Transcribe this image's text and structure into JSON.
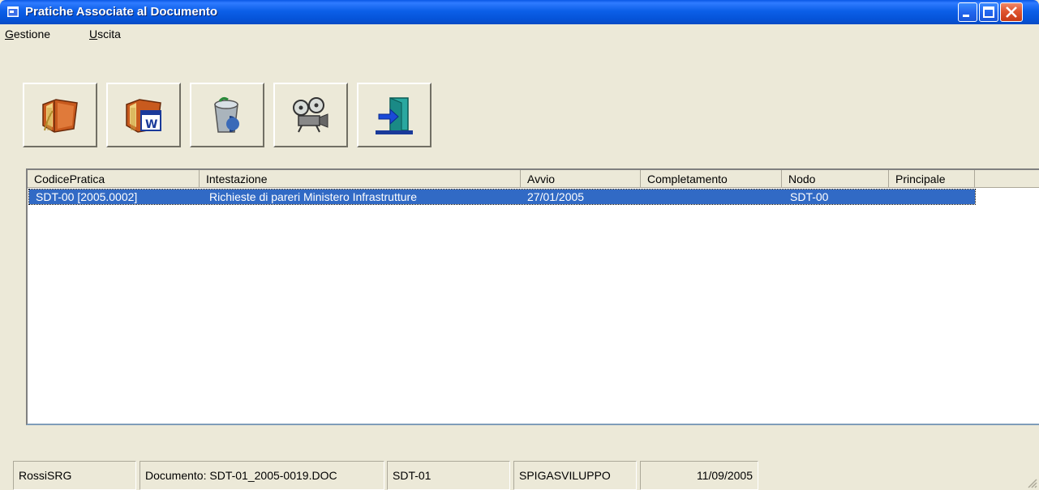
{
  "window": {
    "title": "Pratiche Associate al Documento"
  },
  "menu": {
    "items": [
      {
        "accel": "G",
        "rest": "estione"
      },
      {
        "accel": "U",
        "rest": "scita"
      }
    ]
  },
  "toolbar": {
    "buttons": [
      {
        "icon": "open-book-icon"
      },
      {
        "icon": "book-word-document-icon"
      },
      {
        "icon": "recycle-bin-icon"
      },
      {
        "icon": "film-projector-icon"
      },
      {
        "icon": "exit-door-icon"
      }
    ]
  },
  "list": {
    "columns": [
      "CodicePratica",
      "Intestazione",
      "Avvio",
      "Completamento",
      "Nodo",
      "Principale"
    ],
    "rows": [
      {
        "codice": "SDT-00 [2005.0002]",
        "intestazione": "Richieste di pareri Ministero Infrastrutture",
        "avvio": "27/01/2005",
        "completamento": "",
        "nodo": "SDT-00",
        "principale": ""
      }
    ],
    "selection_color": "#316ac5"
  },
  "status": {
    "user": "RossiSRG",
    "document": "Documento: SDT-01_2005-0019.DOC",
    "node": "SDT-01",
    "company": "SPIGASVILUPPO",
    "date": "11/09/2005"
  },
  "colors": {
    "titlebar": "#0553d8",
    "face": "#ece9d8",
    "close": "#e0552f"
  }
}
